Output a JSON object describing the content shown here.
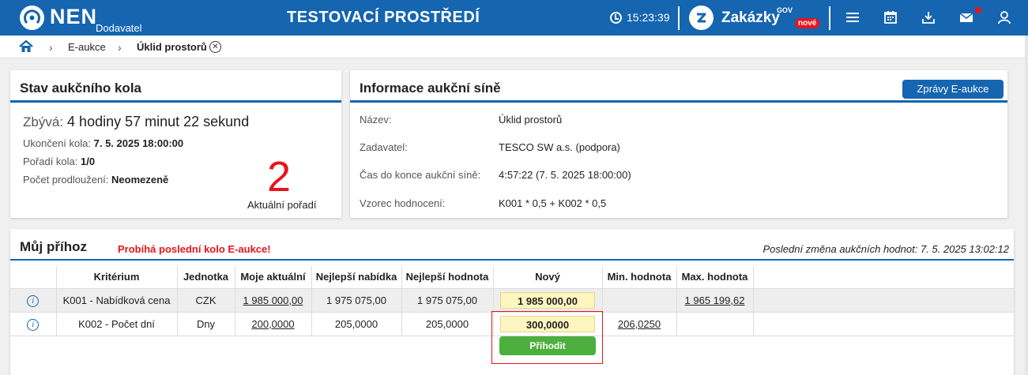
{
  "header": {
    "logo": "NEN",
    "logo_sub": "Dodavatel",
    "env_title": "TESTOVACÍ PROSTŘEDÍ",
    "time": "15:23:39",
    "zakazky": "Zakázky",
    "gov": "GOV",
    "nove": "nové",
    "colors": {
      "bar": "#1565b0",
      "badge": "#e8141e"
    }
  },
  "breadcrumb": {
    "items": [
      "E-aukce",
      "Úklid prostorů"
    ]
  },
  "round_status": {
    "title": "Stav aukčního kola",
    "remaining_label": "Zbývá:",
    "remaining_value": "4 hodiny 57 minut 22 sekund",
    "end_label": "Ukončení kola:",
    "end_value": "7. 5. 2025 18:00:00",
    "order_label": "Pořadí kola:",
    "order_value": "1/0",
    "ext_label": "Počet prodloužení:",
    "ext_value": "Neomezeně",
    "rank": "2",
    "rank_label": "Aktuální pořadí"
  },
  "auction_info": {
    "title": "Informace aukční síně",
    "button": "Zprávy E-aukce",
    "rows": [
      {
        "label": "Název:",
        "value": "Úklid prostorů"
      },
      {
        "label": "Zadavatel:",
        "value": "TESCO SW a.s. (podpora)"
      },
      {
        "label": "Čas do konce aukční síně:",
        "value": "4:57:22 (7. 5. 2025 18:00:00)"
      },
      {
        "label": "Vzorec hodnocení:",
        "value": "K001 * 0,5 + K002 * 0,5"
      }
    ]
  },
  "my_bid": {
    "title": "Můj příhoz",
    "warning": "Probíhá poslední kolo E-aukce!",
    "last_change": "Poslední změna aukčních hodnot: 7. 5. 2025 13:02:12",
    "columns": [
      "Kritérium",
      "Jednotka",
      "Moje aktuální",
      "Nejlepší nabídka",
      "Nejlepší hodnota",
      "Nový",
      "Min. hodnota",
      "Max. hodnota"
    ],
    "rows": [
      {
        "criterion": "K001 - Nabídková cena",
        "unit": "CZK",
        "mine": "1 985 000,00",
        "best_offer": "1 975 075,00",
        "best_value": "1 975 075,00",
        "new": "1 985 000,00",
        "min": "",
        "max": "1 965 199,62"
      },
      {
        "criterion": "K002 - Počet dní",
        "unit": "Dny",
        "mine": "200,0000",
        "best_offer": "205,0000",
        "best_value": "205,0000",
        "new": "300,0000",
        "min": "206,0250",
        "max": ""
      }
    ],
    "submit": "Přihodit"
  }
}
